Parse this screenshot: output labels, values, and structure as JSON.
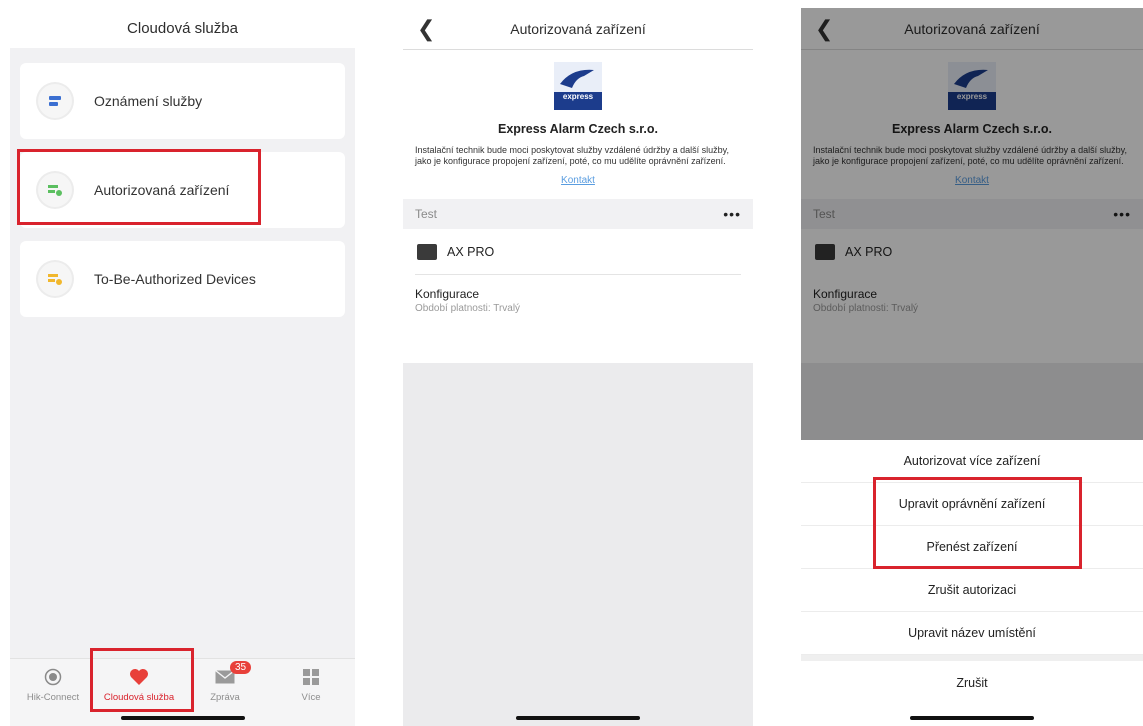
{
  "panel1": {
    "title": "Cloudová služba",
    "cards": [
      {
        "label": "Oznámení služby",
        "icon": "notification-icon"
      },
      {
        "label": "Autorizovaná zařízení",
        "icon": "authorized-devices-icon"
      },
      {
        "label": "To-Be-Authorized Devices",
        "icon": "pending-devices-icon"
      }
    ],
    "tabs": [
      {
        "label": "Hik-Connect",
        "icon": "hik-connect-icon"
      },
      {
        "label": "Cloudová služba",
        "icon": "heart-icon"
      },
      {
        "label": "Zpráva",
        "icon": "mail-icon",
        "badge": "35"
      },
      {
        "label": "Více",
        "icon": "grid-icon"
      }
    ]
  },
  "panel2": {
    "title": "Autorizovaná zařízení",
    "company": "Express Alarm Czech s.r.o.",
    "logo_text": "express",
    "description": "Instalační technik bude moci poskytovat služby vzdálené údržby a další služby, jako je konfigurace propojení zařízení, poté, co mu udělíte oprávnění zařízení.",
    "contact": "Kontakt",
    "section": "Test",
    "more": "•••",
    "device": "AX PRO",
    "config_title": "Konfigurace",
    "config_sub": "Období platnosti:  Trvalý"
  },
  "panel3": {
    "sheet_options": [
      "Autorizovat více zařízení",
      "Upravit oprávnění zařízení",
      "Přenést zařízení",
      "Zrušit autorizaci",
      "Upravit název umístění"
    ],
    "cancel": "Zrušit"
  },
  "colors": {
    "highlight": "#d9232d",
    "accent": "#d9232d",
    "link": "#5a9de0"
  }
}
